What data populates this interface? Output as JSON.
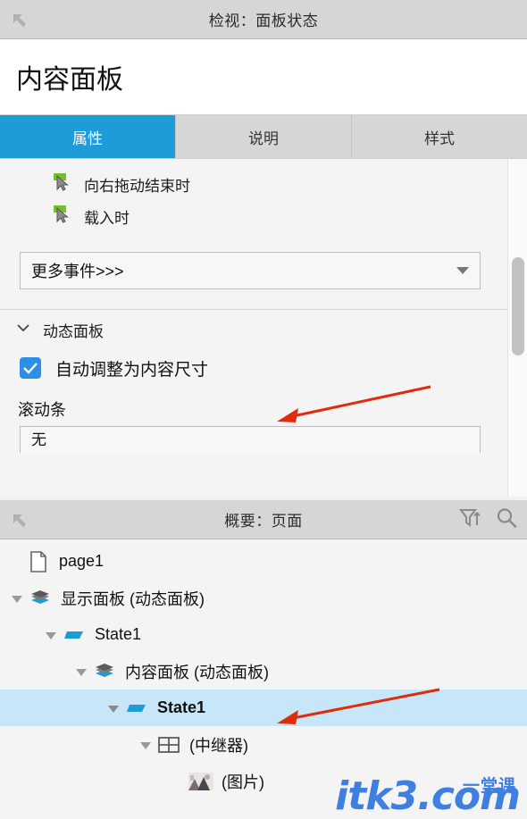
{
  "inspector": {
    "header_title": "检视：面板状态",
    "collapse_icon": "collapse-arrow-icon",
    "widget_name": "内容面板",
    "tabs": [
      {
        "label": "属性",
        "active": true
      },
      {
        "label": "说明",
        "active": false
      },
      {
        "label": "样式",
        "active": false
      }
    ],
    "events": [
      {
        "label": "向右拖动结束时",
        "icon": "cursor-event-icon"
      },
      {
        "label": "载入时",
        "icon": "cursor-event-icon"
      }
    ],
    "more_events": {
      "label": "更多事件>>>",
      "caret_icon": "chevron-down-icon"
    },
    "dynamic_panel": {
      "section_title": "动态面板",
      "chevron_icon": "chevron-down-icon",
      "fit_to_content": {
        "label": "自动调整为内容尺寸",
        "checked": true,
        "check_icon": "checkmark-icon"
      },
      "scrollbar_label": "滚动条",
      "scrollbar_value": "无"
    }
  },
  "outline": {
    "header_title": "概要：页面",
    "collapse_icon": "collapse-arrow-icon",
    "filter_icon": "filter-icon",
    "search_icon": "search-icon",
    "tree": [
      {
        "label": "page1",
        "icon": "page-icon",
        "depth": 0,
        "twisty": "none",
        "selected": false
      },
      {
        "label": "显示面板 (动态面板)",
        "icon": "dynamic-panel-icon",
        "depth": 1,
        "twisty": "expanded",
        "selected": false
      },
      {
        "label": "State1",
        "icon": "panel-state-icon",
        "depth": 2,
        "twisty": "expanded",
        "selected": false
      },
      {
        "label": "内容面板 (动态面板)",
        "icon": "dynamic-panel-icon",
        "depth": 3,
        "twisty": "expanded",
        "selected": false
      },
      {
        "label": "State1",
        "icon": "panel-state-icon",
        "depth": 4,
        "twisty": "expanded",
        "selected": true
      },
      {
        "label": "(中继器)",
        "icon": "repeater-icon",
        "depth": 5,
        "twisty": "expanded",
        "selected": false
      },
      {
        "label": "(图片)",
        "icon": "image-thumbnail-icon",
        "depth": 6,
        "twisty": "none",
        "selected": false
      }
    ]
  },
  "watermark": {
    "main_text": "itk3.com",
    "cn_text": "一堂课",
    "color": "#3f7fe0"
  },
  "annotations": {
    "arrow_color": "#e02b0c",
    "arrows": [
      {
        "name": "arrow-to-fit-to-content"
      },
      {
        "name": "arrow-to-selected-state"
      }
    ]
  },
  "colors": {
    "accent_tab": "#1d9cd8",
    "checkbox": "#2b8fe8",
    "selection": "#c7e6f7",
    "header_bar": "#d6d6d6",
    "event_icon_green": "#72c02c"
  }
}
